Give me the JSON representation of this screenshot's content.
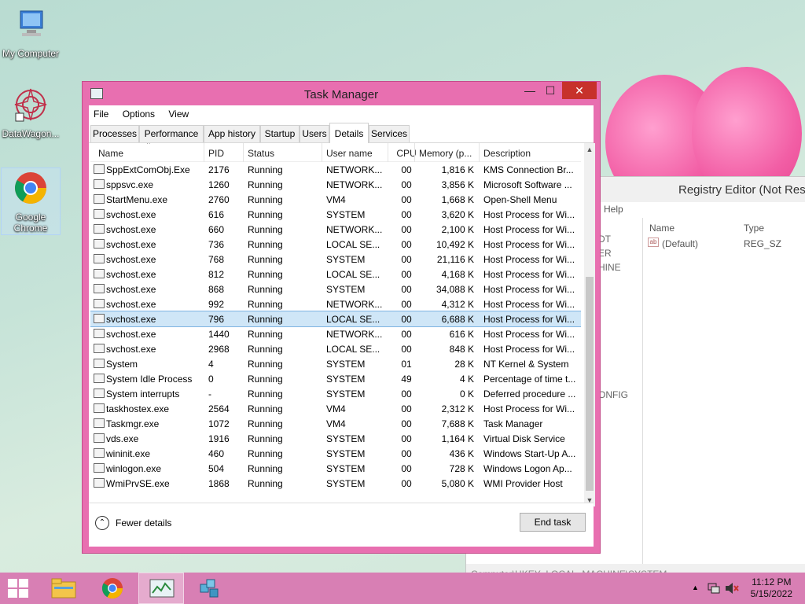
{
  "desktop": {
    "icons": [
      {
        "label": "My Computer"
      },
      {
        "label": "DataWagon..."
      },
      {
        "label": "Google Chrome"
      }
    ]
  },
  "registry": {
    "title": "Registry Editor (Not Resp",
    "menu": "Help",
    "tree_items": [
      "DT",
      "ER",
      "HINE",
      "ONFIG"
    ],
    "columns": [
      "Name",
      "Type"
    ],
    "rows": [
      {
        "name": "(Default)",
        "type": "REG_SZ"
      }
    ],
    "status": "Computer\\HKEY_LOCAL_MACHINE\\SYSTEM"
  },
  "taskmanager": {
    "title": "Task Manager",
    "menu": [
      "File",
      "Options",
      "View"
    ],
    "tabs": [
      "Processes",
      "Performance",
      "App history",
      "Startup",
      "Users",
      "Details",
      "Services"
    ],
    "active_tab": "Details",
    "columns": [
      "Name",
      "PID",
      "Status",
      "User name",
      "CPU",
      "Memory (p...",
      "Description"
    ],
    "rows": [
      {
        "name": "SppExtComObj.Exe",
        "pid": "2176",
        "status": "Running",
        "user": "NETWORK...",
        "cpu": "00",
        "mem": "1,816 K",
        "desc": "KMS Connection Br..."
      },
      {
        "name": "sppsvc.exe",
        "pid": "1260",
        "status": "Running",
        "user": "NETWORK...",
        "cpu": "00",
        "mem": "3,856 K",
        "desc": "Microsoft Software ..."
      },
      {
        "name": "StartMenu.exe",
        "pid": "2760",
        "status": "Running",
        "user": "VM4",
        "cpu": "00",
        "mem": "1,668 K",
        "desc": "Open-Shell Menu"
      },
      {
        "name": "svchost.exe",
        "pid": "616",
        "status": "Running",
        "user": "SYSTEM",
        "cpu": "00",
        "mem": "3,620 K",
        "desc": "Host Process for Wi..."
      },
      {
        "name": "svchost.exe",
        "pid": "660",
        "status": "Running",
        "user": "NETWORK...",
        "cpu": "00",
        "mem": "2,100 K",
        "desc": "Host Process for Wi..."
      },
      {
        "name": "svchost.exe",
        "pid": "736",
        "status": "Running",
        "user": "LOCAL SE...",
        "cpu": "00",
        "mem": "10,492 K",
        "desc": "Host Process for Wi..."
      },
      {
        "name": "svchost.exe",
        "pid": "768",
        "status": "Running",
        "user": "SYSTEM",
        "cpu": "00",
        "mem": "21,116 K",
        "desc": "Host Process for Wi..."
      },
      {
        "name": "svchost.exe",
        "pid": "812",
        "status": "Running",
        "user": "LOCAL SE...",
        "cpu": "00",
        "mem": "4,168 K",
        "desc": "Host Process for Wi..."
      },
      {
        "name": "svchost.exe",
        "pid": "868",
        "status": "Running",
        "user": "SYSTEM",
        "cpu": "00",
        "mem": "34,088 K",
        "desc": "Host Process for Wi..."
      },
      {
        "name": "svchost.exe",
        "pid": "992",
        "status": "Running",
        "user": "NETWORK...",
        "cpu": "00",
        "mem": "4,312 K",
        "desc": "Host Process for Wi..."
      },
      {
        "name": "svchost.exe",
        "pid": "796",
        "status": "Running",
        "user": "LOCAL SE...",
        "cpu": "00",
        "mem": "6,688 K",
        "desc": "Host Process for Wi..."
      },
      {
        "name": "svchost.exe",
        "pid": "1440",
        "status": "Running",
        "user": "NETWORK...",
        "cpu": "00",
        "mem": "616 K",
        "desc": "Host Process for Wi..."
      },
      {
        "name": "svchost.exe",
        "pid": "2968",
        "status": "Running",
        "user": "LOCAL SE...",
        "cpu": "00",
        "mem": "848 K",
        "desc": "Host Process for Wi..."
      },
      {
        "name": "System",
        "pid": "4",
        "status": "Running",
        "user": "SYSTEM",
        "cpu": "01",
        "mem": "28 K",
        "desc": "NT Kernel & System"
      },
      {
        "name": "System Idle Process",
        "pid": "0",
        "status": "Running",
        "user": "SYSTEM",
        "cpu": "49",
        "mem": "4 K",
        "desc": "Percentage of time t..."
      },
      {
        "name": "System interrupts",
        "pid": "-",
        "status": "Running",
        "user": "SYSTEM",
        "cpu": "00",
        "mem": "0 K",
        "desc": "Deferred procedure ..."
      },
      {
        "name": "taskhostex.exe",
        "pid": "2564",
        "status": "Running",
        "user": "VM4",
        "cpu": "00",
        "mem": "2,312 K",
        "desc": "Host Process for Wi..."
      },
      {
        "name": "Taskmgr.exe",
        "pid": "1072",
        "status": "Running",
        "user": "VM4",
        "cpu": "00",
        "mem": "7,688 K",
        "desc": "Task Manager"
      },
      {
        "name": "vds.exe",
        "pid": "1916",
        "status": "Running",
        "user": "SYSTEM",
        "cpu": "00",
        "mem": "1,164 K",
        "desc": "Virtual Disk Service"
      },
      {
        "name": "wininit.exe",
        "pid": "460",
        "status": "Running",
        "user": "SYSTEM",
        "cpu": "00",
        "mem": "436 K",
        "desc": "Windows Start-Up A..."
      },
      {
        "name": "winlogon.exe",
        "pid": "504",
        "status": "Running",
        "user": "SYSTEM",
        "cpu": "00",
        "mem": "728 K",
        "desc": "Windows Logon Ap..."
      },
      {
        "name": "WmiPrvSE.exe",
        "pid": "1868",
        "status": "Running",
        "user": "SYSTEM",
        "cpu": "00",
        "mem": "5,080 K",
        "desc": "WMI Provider Host"
      }
    ],
    "selected_row": 10,
    "fewer_details": "Fewer details",
    "end_task": "End task"
  },
  "taskbar": {
    "time": "11:12 PM",
    "date": "5/15/2022"
  },
  "colors": {
    "accent": "#e86fb0",
    "taskbar": "#d87fb4",
    "close": "#c7312b",
    "selection": "#cfe6f7"
  }
}
